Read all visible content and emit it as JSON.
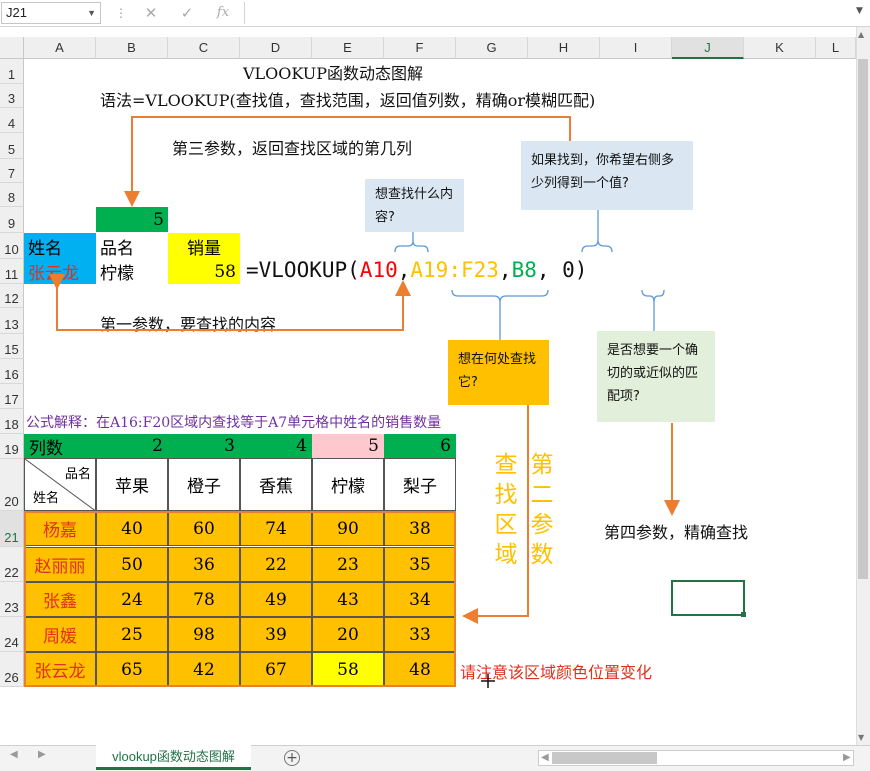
{
  "app": {
    "name_box": "J21",
    "fx_label": "fx",
    "cancel_glyph": "✕",
    "enter_glyph": "✓",
    "sheet_tab": "vlookup函数动态图解",
    "add_sheet": "+",
    "columns": [
      "A",
      "B",
      "C",
      "D",
      "E",
      "F",
      "G",
      "H",
      "I",
      "J",
      "K",
      "L"
    ],
    "selected_column": "J",
    "rows": [
      "1",
      "3",
      "4",
      "5",
      "7",
      "8",
      "9",
      "10",
      "11",
      "12",
      "13",
      "15",
      "16",
      "17",
      "18",
      "19",
      "20",
      "21",
      "22",
      "23",
      "24",
      "26"
    ],
    "selected_row": "21"
  },
  "content": {
    "title": "VLOOKUP函数动态图解",
    "syntax": "语法=VLOOKUP(查找值，查找范围，返回值列数，精确or模糊匹配)",
    "param3": "第三参数，返回查找区域的第几列",
    "param1": "第一参数，要查找的内容",
    "param4": "第四参数，精确查找",
    "note_what": "想查找什么内容?",
    "note_where": "想在何处查找它?",
    "note_howmany": "如果找到，你希望右侧多少列得到一个值?",
    "note_exact": "是否想要一个确切的或近似的匹配项?",
    "vert_1": "查找区域",
    "vert_2": "第二参数",
    "attention": "请注意该区域颜色位置变化",
    "formula_explain": "公式解释：在A16:F20区域内查找等于A7单元格中姓名的销售数量",
    "b8_value": "5",
    "header_name": "姓名",
    "header_product": "品名",
    "header_sales": "销量",
    "lookup_name": "张云龙",
    "lookup_product": "柠檬",
    "lookup_sales": "58",
    "formula": {
      "prefix": "=VLOOKUP(",
      "arg1": "A10",
      "comma1": ",",
      "arg2": "A19:F23",
      "comma2": ",",
      "arg3": "B8",
      "rest": ",  0)"
    }
  },
  "table": {
    "col_index_label": "列数",
    "col_index": [
      "2",
      "3",
      "4",
      "5",
      "6"
    ],
    "diag_top": "品名",
    "diag_bottom": "姓名",
    "headers": [
      "苹果",
      "橙子",
      "香蕉",
      "柠檬",
      "梨子"
    ],
    "rows": [
      {
        "name": "杨嘉",
        "values": [
          "40",
          "60",
          "74",
          "90",
          "38"
        ]
      },
      {
        "name": "赵丽丽",
        "values": [
          "50",
          "36",
          "22",
          "23",
          "35"
        ]
      },
      {
        "name": "张鑫",
        "values": [
          "24",
          "78",
          "49",
          "43",
          "34"
        ]
      },
      {
        "name": "周媛",
        "values": [
          "25",
          "98",
          "39",
          "20",
          "33"
        ]
      },
      {
        "name": "张云龙",
        "values": [
          "65",
          "42",
          "67",
          "58",
          "48"
        ]
      }
    ]
  },
  "colors": {
    "green": "#00b050",
    "blue": "#00b0f0",
    "yellow": "#ffff00",
    "orange": "#ffc000",
    "red": "#ff0000",
    "pink": "#ffc7ce",
    "note_blue": "#dae7f3",
    "note_green": "#e2efda",
    "arrow": "#ed7d31",
    "bracket": "#5b9bd5"
  }
}
